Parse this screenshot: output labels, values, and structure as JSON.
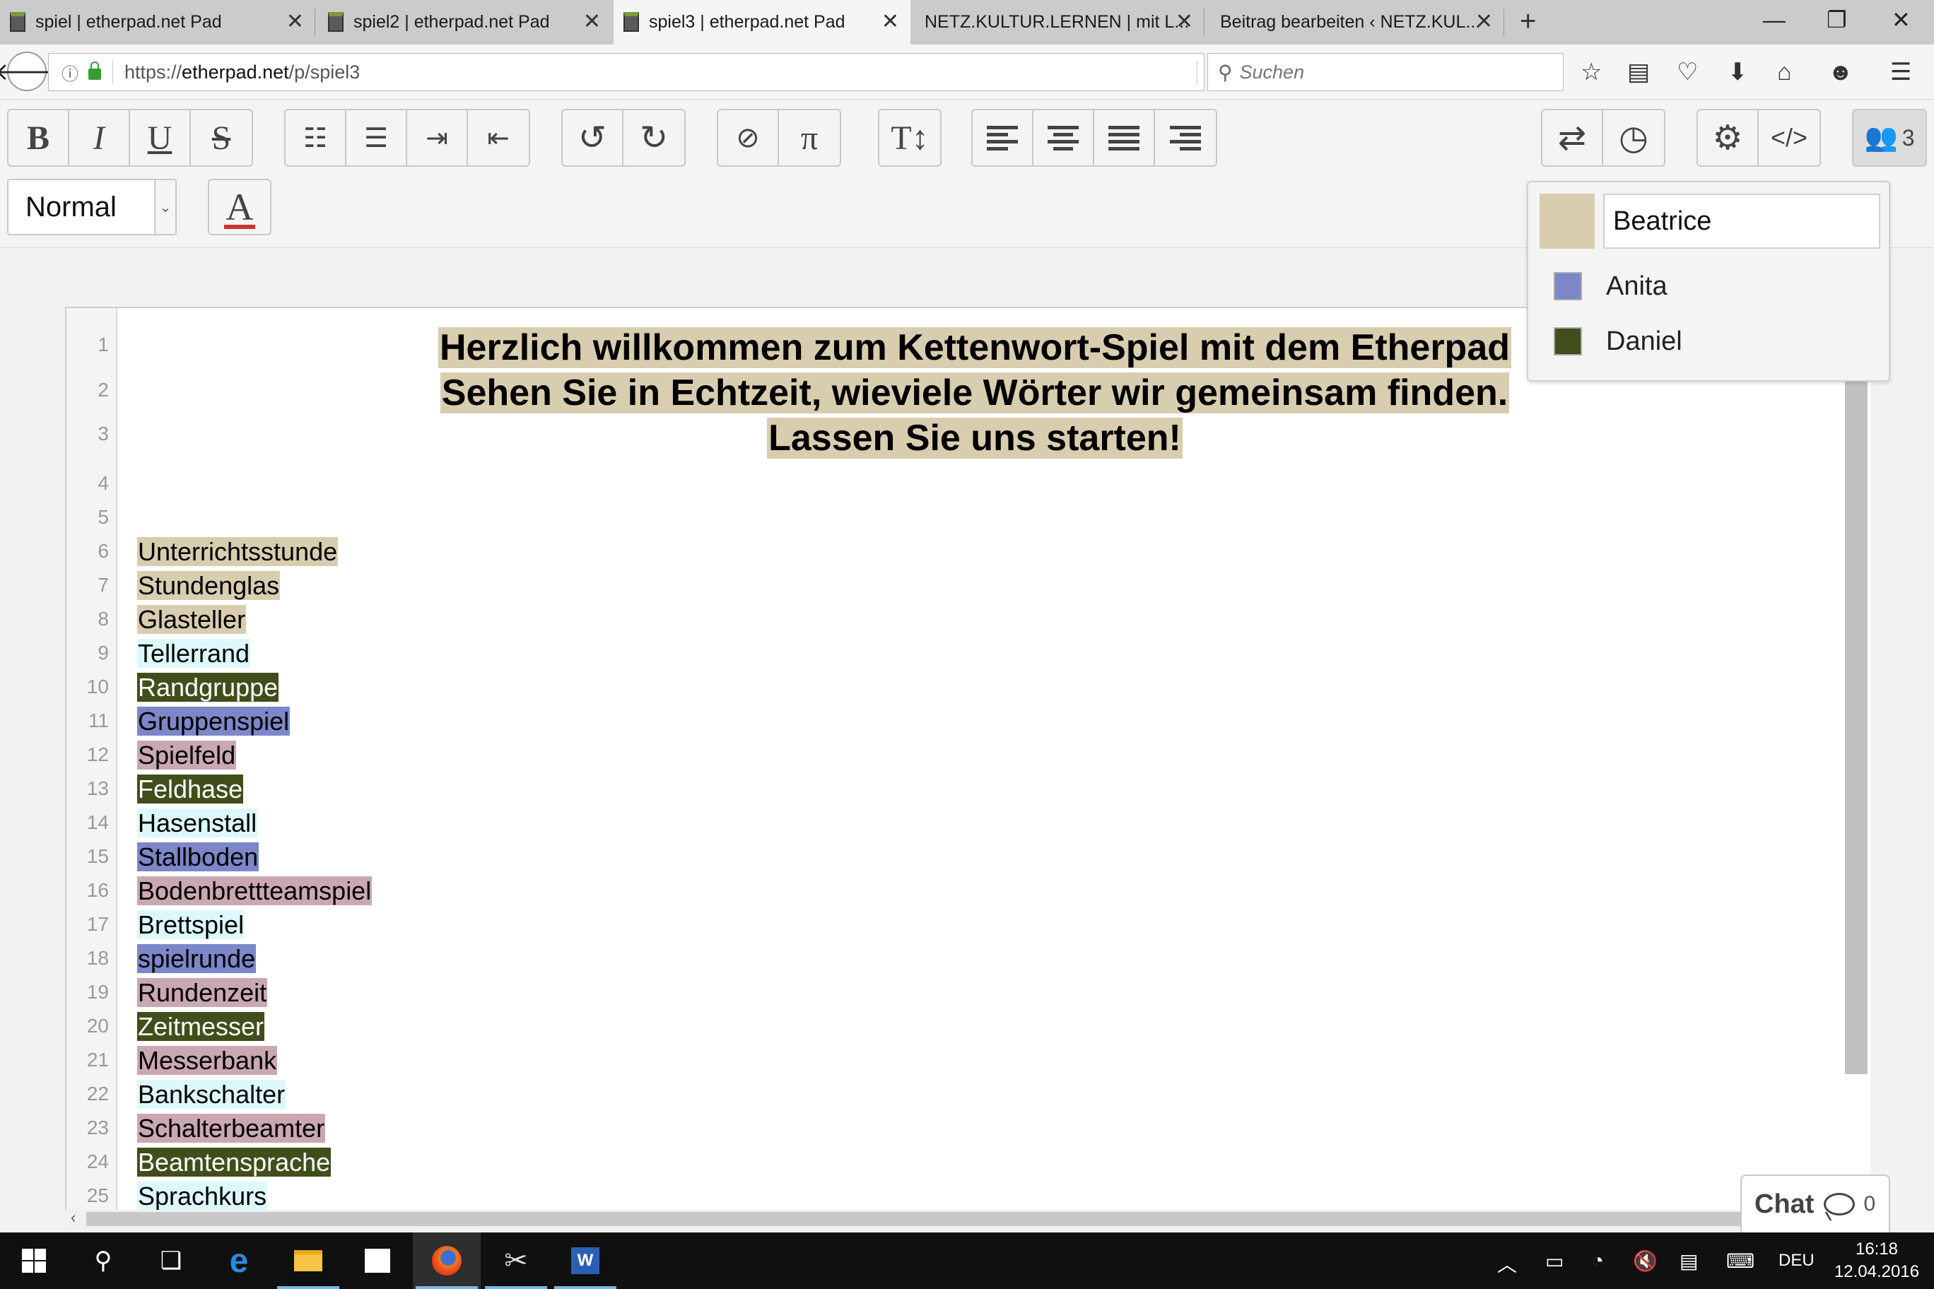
{
  "browser": {
    "tabs": [
      {
        "title": "spiel | etherpad.net Pad",
        "active": false
      },
      {
        "title": "spiel2 | etherpad.net Pad",
        "active": false
      },
      {
        "title": "spiel3 | etherpad.net Pad",
        "active": true
      },
      {
        "title": "NETZ.KULTUR.LERNEN | mit L...",
        "active": false
      },
      {
        "title": "Beitrag bearbeiten ‹ NETZ.KUL...",
        "active": false
      }
    ],
    "url_prefix": "https://",
    "url_domain": "etherpad.net",
    "url_path": "/p/spiel3",
    "search_placeholder": "Suchen"
  },
  "toolbar": {
    "heading_value": "Normal",
    "users_count": "3"
  },
  "document": {
    "heading": [
      "Herzlich willkommen zum Kettenwort-Spiel mit dem Etherpad",
      "Sehen Sie in Echtzeit, wieviele Wörter wir gemeinsam finden.",
      "Lassen Sie uns starten!"
    ],
    "words": [
      {
        "line": 6,
        "text": "Unterrichtsstunde",
        "author": "beatrice"
      },
      {
        "line": 7,
        "text": "Stundenglas",
        "author": "beatrice"
      },
      {
        "line": 8,
        "text": "Glasteller",
        "author": "beatrice"
      },
      {
        "line": 9,
        "text": "Tellerrand",
        "author": "cyan"
      },
      {
        "line": 10,
        "text": "Randgruppe",
        "author": "daniel"
      },
      {
        "line": 11,
        "text": "Gruppenspiel",
        "author": "anita"
      },
      {
        "line": 12,
        "text": "Spielfeld",
        "author": "pink"
      },
      {
        "line": 13,
        "text": "Feldhase",
        "author": "daniel"
      },
      {
        "line": 14,
        "text": "Hasenstall",
        "author": "cyan"
      },
      {
        "line": 15,
        "text": "Stallboden",
        "author": "anita"
      },
      {
        "line": 16,
        "text": "Bodenbrettteamspiel",
        "author": "pink"
      },
      {
        "line": 17,
        "text": "Brettspiel",
        "author": "cyan"
      },
      {
        "line": 18,
        "text": "spielrunde",
        "author": "anita"
      },
      {
        "line": 19,
        "text": "Rundenzeit",
        "author": "pink"
      },
      {
        "line": 20,
        "text": "Zeitmesser",
        "author": "daniel"
      },
      {
        "line": 21,
        "text": "Messerbank",
        "author": "pink"
      },
      {
        "line": 22,
        "text": "Bankschalter",
        "author": "cyan"
      },
      {
        "line": 23,
        "text": "Schalterbeamter",
        "author": "pink"
      },
      {
        "line": 24,
        "text": "Beamtensprache",
        "author": "daniel"
      },
      {
        "line": 25,
        "text": "Sprachkurs",
        "author": "cyan"
      }
    ],
    "line_numbers": [
      "1",
      "2",
      "3",
      "4",
      "5",
      "6",
      "7",
      "8",
      "9",
      "10",
      "11",
      "12",
      "13",
      "14",
      "15",
      "16",
      "17",
      "18",
      "19",
      "20",
      "21",
      "22",
      "23",
      "24",
      "25"
    ]
  },
  "author_colors": {
    "beatrice": "#d9cdb0",
    "anita": "#7b87c8",
    "daniel": "#404e1b",
    "pink": "#caa8b2",
    "cyan": "#dcf8fb"
  },
  "users": {
    "me": {
      "name": "Beatrice",
      "color": "#d9cdb0"
    },
    "others": [
      {
        "name": "Anita",
        "color": "#7b87c8"
      },
      {
        "name": "Daniel",
        "color": "#404e1b"
      }
    ]
  },
  "chat": {
    "label": "Chat",
    "count": "0"
  },
  "taskbar": {
    "time": "16:18",
    "date": "12.04.2016",
    "language": "DEU"
  }
}
